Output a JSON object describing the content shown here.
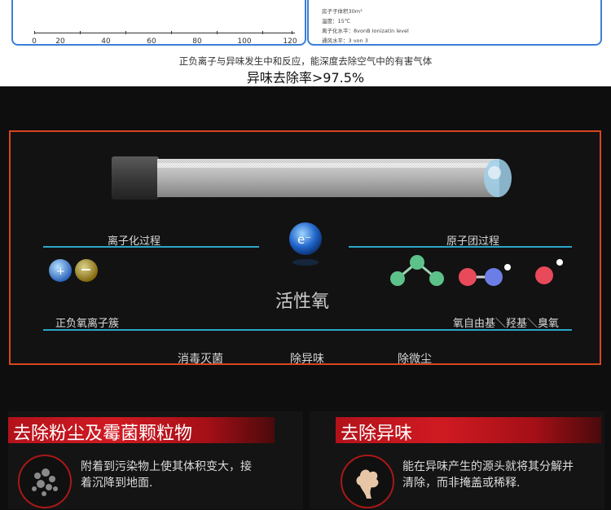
{
  "chart_strip": {
    "ticks": [
      "0",
      "20",
      "40",
      "60",
      "80",
      "100",
      "120"
    ]
  },
  "specs": {
    "volume": "房子子体积30m³",
    "temp": "温度：15℃",
    "ion_level": "离子化水平：8vonB Ionizatin level",
    "ventilation": "通风水平：3 von 3"
  },
  "intro": {
    "subtitle": "正负离子与异味发生中和反应，能深度去除空气中的有害气体",
    "rate": "异味去除率>97.5%"
  },
  "diagram": {
    "left_heading": "离子化过程",
    "right_heading": "原子团过程",
    "electron_symbol": "e⁻",
    "center_label": "活性氧",
    "left_caption": "正负氧离子簇",
    "right_caption": "氧自由基＼羟基＼臭氧",
    "effects": [
      "消毒灭菌",
      "除异味",
      "除微尘"
    ]
  },
  "features": [
    {
      "title": "去除粉尘及霉菌颗粒物",
      "text_line1": "附着到污染物上使其体积变大，接",
      "text_line2": "着沉降到地面.",
      "icon": "dust-particles-icon"
    },
    {
      "title": "去除异味",
      "text_line1": "能在异味产生的源头就将其分解并",
      "text_line2": "清除，而非掩盖或稀释.",
      "icon": "odor-cloud-icon"
    }
  ],
  "colors": {
    "frame": "#d8461e",
    "accent_blue": "#2aa6c8",
    "card_border": "#3b7fd8",
    "banner_red": "#c8161e"
  }
}
